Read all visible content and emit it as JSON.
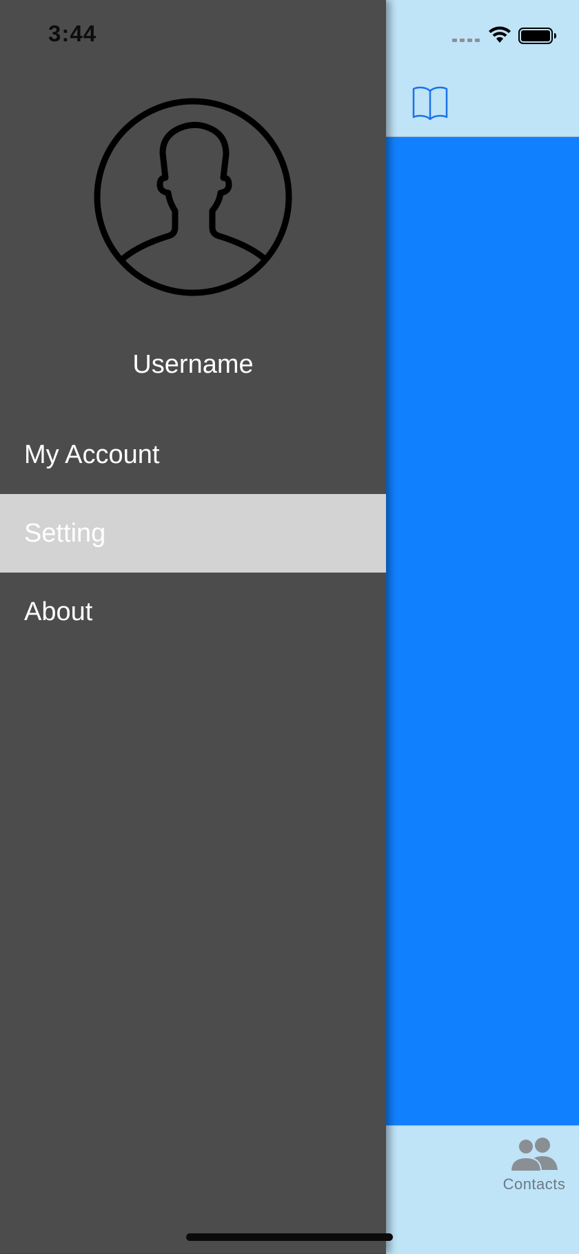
{
  "status_bar": {
    "time": "3:44",
    "icons": [
      "cellular-signal-icon",
      "wifi-icon",
      "battery-icon"
    ]
  },
  "drawer": {
    "avatar_icon": "user-silhouette-icon",
    "username": "Username",
    "menu": [
      {
        "label": "My Account",
        "selected": false
      },
      {
        "label": "Setting",
        "selected": true
      },
      {
        "label": "About",
        "selected": false
      }
    ]
  },
  "main": {
    "nav_icon": "book-icon",
    "tab_bar": {
      "items": [
        {
          "label": "Contacts",
          "icon": "contacts-icon"
        }
      ]
    }
  },
  "colors": {
    "drawer_background": "#4c4c4c",
    "selected_row": "#d3d3d3",
    "main_blue": "#1180fe",
    "bar_background": "#bfe3f7"
  }
}
